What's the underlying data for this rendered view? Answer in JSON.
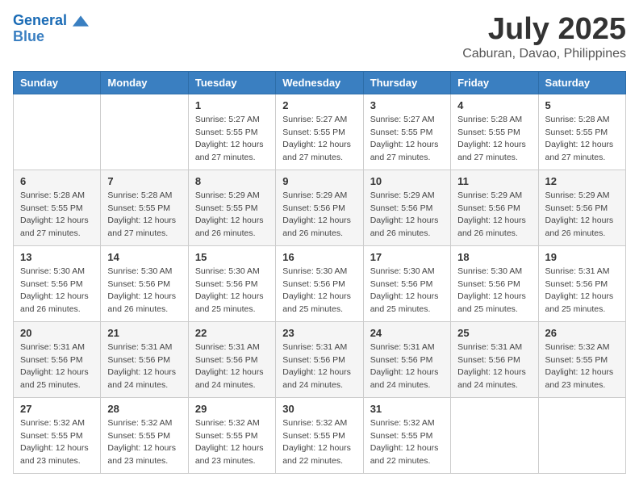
{
  "logo": {
    "line1": "General",
    "line2": "Blue"
  },
  "title": "July 2025",
  "subtitle": "Caburan, Davao, Philippines",
  "weekdays": [
    "Sunday",
    "Monday",
    "Tuesday",
    "Wednesday",
    "Thursday",
    "Friday",
    "Saturday"
  ],
  "weeks": [
    [
      {
        "day": "",
        "sunrise": "",
        "sunset": "",
        "daylight": ""
      },
      {
        "day": "",
        "sunrise": "",
        "sunset": "",
        "daylight": ""
      },
      {
        "day": "1",
        "sunrise": "Sunrise: 5:27 AM",
        "sunset": "Sunset: 5:55 PM",
        "daylight": "Daylight: 12 hours and 27 minutes."
      },
      {
        "day": "2",
        "sunrise": "Sunrise: 5:27 AM",
        "sunset": "Sunset: 5:55 PM",
        "daylight": "Daylight: 12 hours and 27 minutes."
      },
      {
        "day": "3",
        "sunrise": "Sunrise: 5:27 AM",
        "sunset": "Sunset: 5:55 PM",
        "daylight": "Daylight: 12 hours and 27 minutes."
      },
      {
        "day": "4",
        "sunrise": "Sunrise: 5:28 AM",
        "sunset": "Sunset: 5:55 PM",
        "daylight": "Daylight: 12 hours and 27 minutes."
      },
      {
        "day": "5",
        "sunrise": "Sunrise: 5:28 AM",
        "sunset": "Sunset: 5:55 PM",
        "daylight": "Daylight: 12 hours and 27 minutes."
      }
    ],
    [
      {
        "day": "6",
        "sunrise": "Sunrise: 5:28 AM",
        "sunset": "Sunset: 5:55 PM",
        "daylight": "Daylight: 12 hours and 27 minutes."
      },
      {
        "day": "7",
        "sunrise": "Sunrise: 5:28 AM",
        "sunset": "Sunset: 5:55 PM",
        "daylight": "Daylight: 12 hours and 27 minutes."
      },
      {
        "day": "8",
        "sunrise": "Sunrise: 5:29 AM",
        "sunset": "Sunset: 5:55 PM",
        "daylight": "Daylight: 12 hours and 26 minutes."
      },
      {
        "day": "9",
        "sunrise": "Sunrise: 5:29 AM",
        "sunset": "Sunset: 5:56 PM",
        "daylight": "Daylight: 12 hours and 26 minutes."
      },
      {
        "day": "10",
        "sunrise": "Sunrise: 5:29 AM",
        "sunset": "Sunset: 5:56 PM",
        "daylight": "Daylight: 12 hours and 26 minutes."
      },
      {
        "day": "11",
        "sunrise": "Sunrise: 5:29 AM",
        "sunset": "Sunset: 5:56 PM",
        "daylight": "Daylight: 12 hours and 26 minutes."
      },
      {
        "day": "12",
        "sunrise": "Sunrise: 5:29 AM",
        "sunset": "Sunset: 5:56 PM",
        "daylight": "Daylight: 12 hours and 26 minutes."
      }
    ],
    [
      {
        "day": "13",
        "sunrise": "Sunrise: 5:30 AM",
        "sunset": "Sunset: 5:56 PM",
        "daylight": "Daylight: 12 hours and 26 minutes."
      },
      {
        "day": "14",
        "sunrise": "Sunrise: 5:30 AM",
        "sunset": "Sunset: 5:56 PM",
        "daylight": "Daylight: 12 hours and 26 minutes."
      },
      {
        "day": "15",
        "sunrise": "Sunrise: 5:30 AM",
        "sunset": "Sunset: 5:56 PM",
        "daylight": "Daylight: 12 hours and 25 minutes."
      },
      {
        "day": "16",
        "sunrise": "Sunrise: 5:30 AM",
        "sunset": "Sunset: 5:56 PM",
        "daylight": "Daylight: 12 hours and 25 minutes."
      },
      {
        "day": "17",
        "sunrise": "Sunrise: 5:30 AM",
        "sunset": "Sunset: 5:56 PM",
        "daylight": "Daylight: 12 hours and 25 minutes."
      },
      {
        "day": "18",
        "sunrise": "Sunrise: 5:30 AM",
        "sunset": "Sunset: 5:56 PM",
        "daylight": "Daylight: 12 hours and 25 minutes."
      },
      {
        "day": "19",
        "sunrise": "Sunrise: 5:31 AM",
        "sunset": "Sunset: 5:56 PM",
        "daylight": "Daylight: 12 hours and 25 minutes."
      }
    ],
    [
      {
        "day": "20",
        "sunrise": "Sunrise: 5:31 AM",
        "sunset": "Sunset: 5:56 PM",
        "daylight": "Daylight: 12 hours and 25 minutes."
      },
      {
        "day": "21",
        "sunrise": "Sunrise: 5:31 AM",
        "sunset": "Sunset: 5:56 PM",
        "daylight": "Daylight: 12 hours and 24 minutes."
      },
      {
        "day": "22",
        "sunrise": "Sunrise: 5:31 AM",
        "sunset": "Sunset: 5:56 PM",
        "daylight": "Daylight: 12 hours and 24 minutes."
      },
      {
        "day": "23",
        "sunrise": "Sunrise: 5:31 AM",
        "sunset": "Sunset: 5:56 PM",
        "daylight": "Daylight: 12 hours and 24 minutes."
      },
      {
        "day": "24",
        "sunrise": "Sunrise: 5:31 AM",
        "sunset": "Sunset: 5:56 PM",
        "daylight": "Daylight: 12 hours and 24 minutes."
      },
      {
        "day": "25",
        "sunrise": "Sunrise: 5:31 AM",
        "sunset": "Sunset: 5:56 PM",
        "daylight": "Daylight: 12 hours and 24 minutes."
      },
      {
        "day": "26",
        "sunrise": "Sunrise: 5:32 AM",
        "sunset": "Sunset: 5:55 PM",
        "daylight": "Daylight: 12 hours and 23 minutes."
      }
    ],
    [
      {
        "day": "27",
        "sunrise": "Sunrise: 5:32 AM",
        "sunset": "Sunset: 5:55 PM",
        "daylight": "Daylight: 12 hours and 23 minutes."
      },
      {
        "day": "28",
        "sunrise": "Sunrise: 5:32 AM",
        "sunset": "Sunset: 5:55 PM",
        "daylight": "Daylight: 12 hours and 23 minutes."
      },
      {
        "day": "29",
        "sunrise": "Sunrise: 5:32 AM",
        "sunset": "Sunset: 5:55 PM",
        "daylight": "Daylight: 12 hours and 23 minutes."
      },
      {
        "day": "30",
        "sunrise": "Sunrise: 5:32 AM",
        "sunset": "Sunset: 5:55 PM",
        "daylight": "Daylight: 12 hours and 22 minutes."
      },
      {
        "day": "31",
        "sunrise": "Sunrise: 5:32 AM",
        "sunset": "Sunset: 5:55 PM",
        "daylight": "Daylight: 12 hours and 22 minutes."
      },
      {
        "day": "",
        "sunrise": "",
        "sunset": "",
        "daylight": ""
      },
      {
        "day": "",
        "sunrise": "",
        "sunset": "",
        "daylight": ""
      }
    ]
  ]
}
